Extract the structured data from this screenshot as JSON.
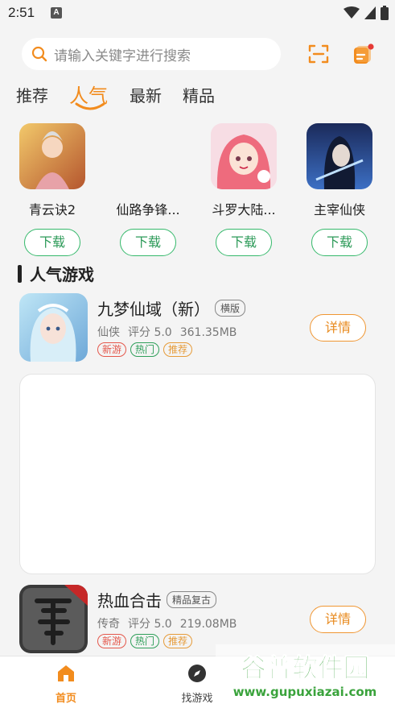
{
  "status_bar": {
    "time": "2:51",
    "notification_glyph": "A"
  },
  "search": {
    "placeholder": "请输入关键字进行搜索"
  },
  "tabs": [
    {
      "label": "推荐",
      "active": false
    },
    {
      "label": "人气",
      "active": true
    },
    {
      "label": "最新",
      "active": false
    },
    {
      "label": "精品",
      "active": false
    }
  ],
  "featured": [
    {
      "name": "青云诀2",
      "download_label": "下载"
    },
    {
      "name": "仙路争锋...",
      "download_label": "下载"
    },
    {
      "name": "斗罗大陆...",
      "download_label": "下载"
    },
    {
      "name": "主宰仙侠",
      "download_label": "下载"
    }
  ],
  "section": {
    "title": "人气游戏"
  },
  "games": [
    {
      "name": "九梦仙域（新）",
      "tag": "横版",
      "genre": "仙侠",
      "score": "评分 5.0",
      "size": "361.35MB",
      "badges": {
        "new": "新游",
        "hot": "热门",
        "rec": "推荐"
      },
      "detail_label": "详情"
    },
    {
      "name": "热血合击",
      "tag": "精品复古",
      "genre": "传奇",
      "score": "评分 5.0",
      "size": "219.08MB",
      "badges": {
        "new": "新游",
        "hot": "热门",
        "rec": "推荐"
      },
      "detail_label": "详情"
    }
  ],
  "bottom_nav": [
    {
      "label": "首页",
      "icon": "home-icon",
      "active": true
    },
    {
      "label": "找游戏",
      "icon": "compass-icon",
      "active": false
    }
  ],
  "watermark": {
    "title": "谷普软件园",
    "url": "www.gupuxiazai.com"
  },
  "colors": {
    "accent": "#f28c1e",
    "download_green": "#35b96b",
    "background": "#f4f4f4"
  }
}
